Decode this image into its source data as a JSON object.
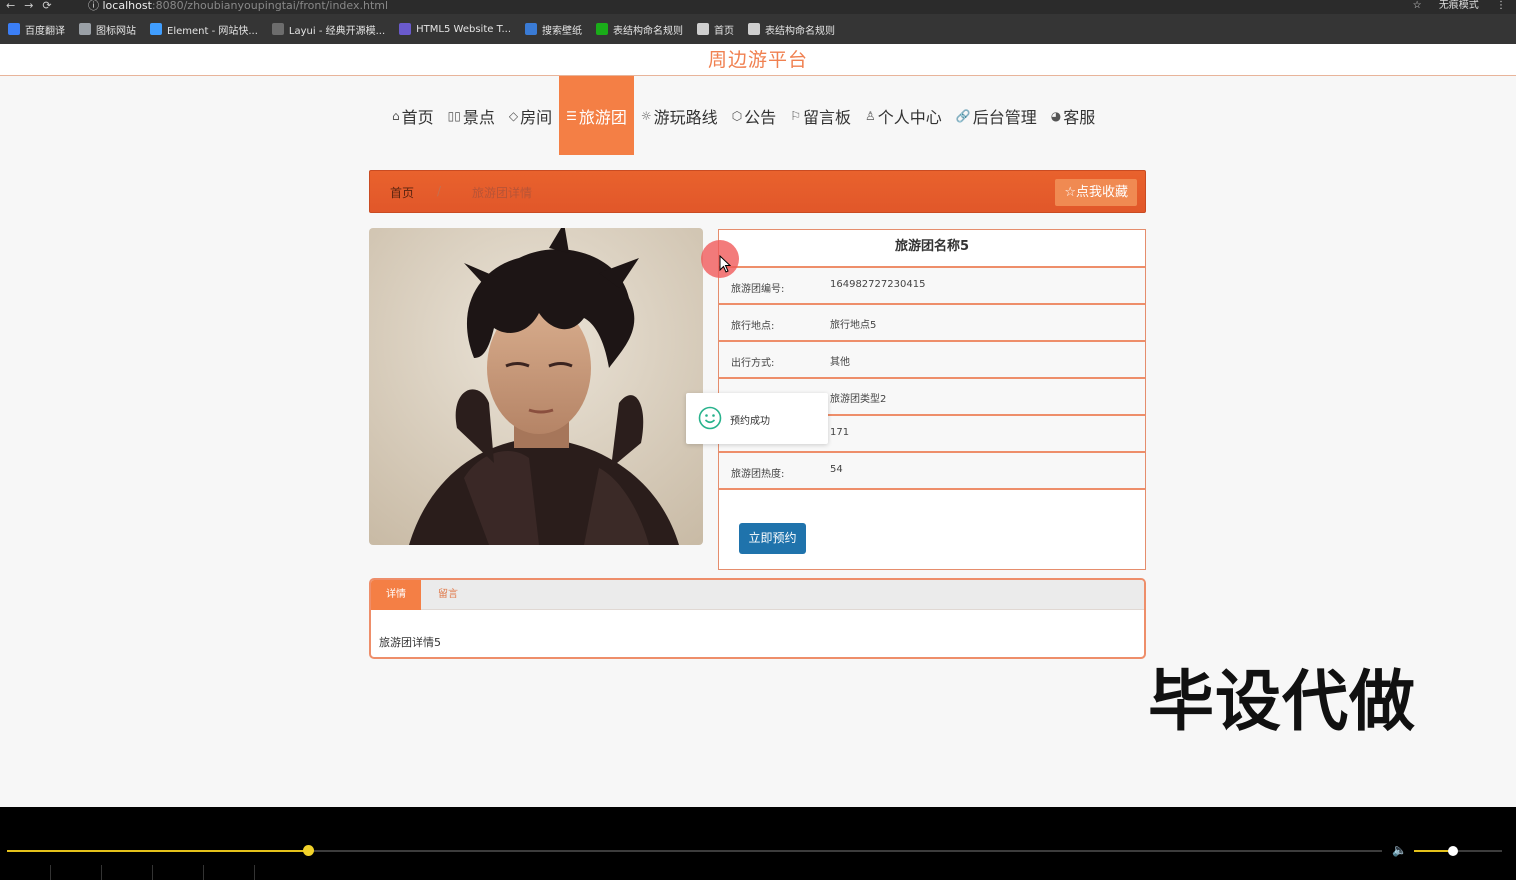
{
  "browser": {
    "url_host": "localhost",
    "url_path": ":8080/zhoubianyoupingtai/front/index.html",
    "mode_label": "无痕模式"
  },
  "bookmarks": [
    {
      "label": "百度翻译",
      "color": "#3b7ef5"
    },
    {
      "label": "图标网站",
      "color": "#9aa0a6"
    },
    {
      "label": "Element - 网站快...",
      "color": "#409eff"
    },
    {
      "label": "Layui - 经典开源模...",
      "color": "#6d6d6d"
    },
    {
      "label": "HTML5 Website T...",
      "color": "#6a5acd"
    },
    {
      "label": "搜索壁纸",
      "color": "#3a7bd5"
    },
    {
      "label": "表结构命名规则",
      "color": "#1aad19"
    },
    {
      "label": "首页",
      "color": "#cfcfcf"
    },
    {
      "label": "表结构命名规则",
      "color": "#cfcfcf"
    }
  ],
  "site": {
    "title": "周边游平台"
  },
  "nav": [
    {
      "label": "首页",
      "icon": "home-icon",
      "glyph": "⌂",
      "active": false
    },
    {
      "label": "景点",
      "icon": "book-icon",
      "glyph": "▯▯",
      "active": false
    },
    {
      "label": "房间",
      "icon": "tag-icon",
      "glyph": "◇",
      "active": false
    },
    {
      "label": "旅游团",
      "icon": "list-icon",
      "glyph": "☰",
      "active": true
    },
    {
      "label": "游玩路线",
      "icon": "sun-icon",
      "glyph": "☼",
      "active": false
    },
    {
      "label": "公告",
      "icon": "cube-icon",
      "glyph": "⬡",
      "active": false
    },
    {
      "label": "留言板",
      "icon": "flag-icon",
      "glyph": "⚐",
      "active": false
    },
    {
      "label": "个人中心",
      "icon": "user-icon",
      "glyph": "♙",
      "active": false
    },
    {
      "label": "后台管理",
      "icon": "link-icon",
      "glyph": "🔗",
      "active": false
    },
    {
      "label": "客服",
      "icon": "chat-icon",
      "glyph": "◕",
      "active": false
    }
  ],
  "breadcrumb": {
    "home": "首页",
    "separator": "/",
    "current": "旅游团详情"
  },
  "favorite_button": "☆点我收藏",
  "detail": {
    "name": "旅游团名称5",
    "rows": [
      {
        "label": "旅游团编号:",
        "value": "164982727230415"
      },
      {
        "label": "旅行地点:",
        "value": "旅行地点5"
      },
      {
        "label": "出行方式:",
        "value": "其他"
      },
      {
        "label": "",
        "value": "旅游团类型2"
      },
      {
        "label": "",
        "value": "171"
      },
      {
        "label": "旅游团热度:",
        "value": "54"
      }
    ],
    "book_button": "立即预约"
  },
  "toast": {
    "text": "预约成功"
  },
  "tabs": {
    "active": "详情",
    "other": "留言",
    "content": "旅游团详情5"
  },
  "watermark": "毕设代做",
  "player": {
    "progress": 0.219,
    "volume": 0.44
  },
  "colors": {
    "accent": "#f47f45",
    "crumb": "#e15a2b",
    "button": "#1f73ac"
  }
}
